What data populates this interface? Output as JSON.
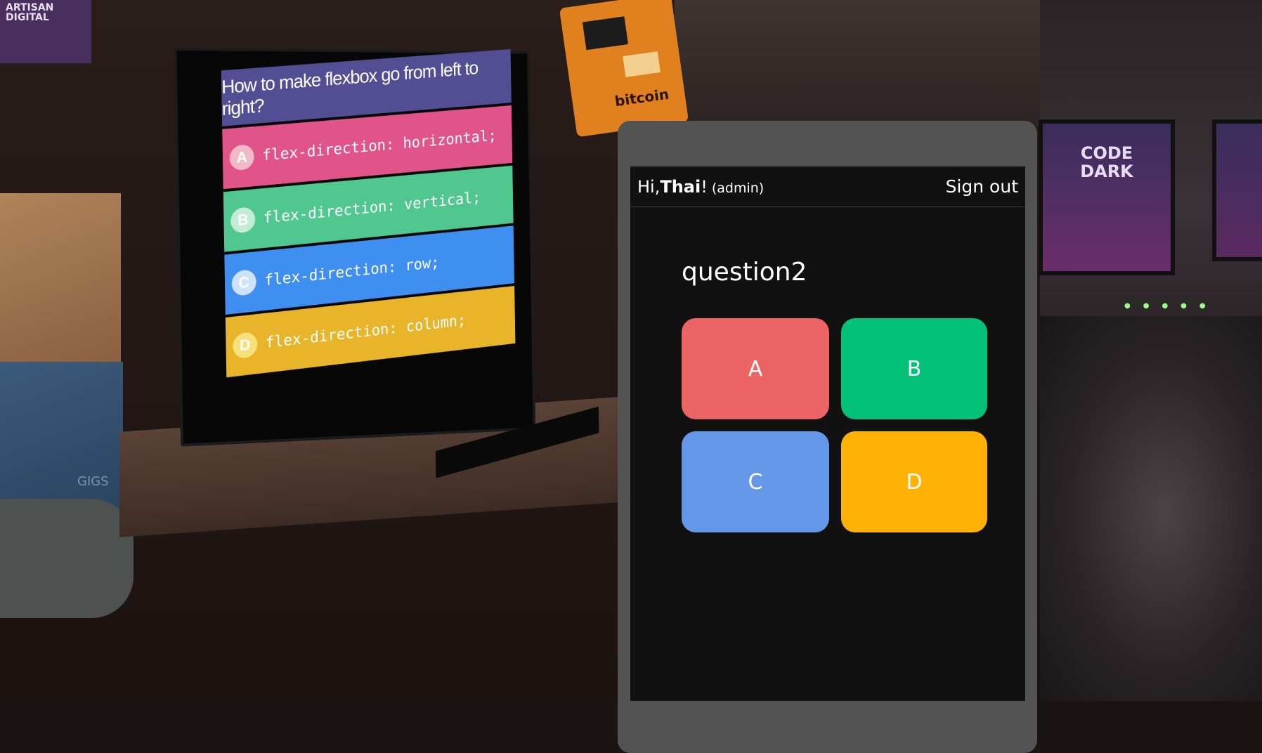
{
  "photo": {
    "banner_text": "ARTISAN DIGITAL",
    "atm_text": "bitcoin",
    "box_label": "GIGS",
    "monitor_text": "CODE DARK"
  },
  "tv": {
    "question": "How to make flexbox go from left to right?",
    "answers": [
      {
        "badge": "A",
        "code": "flex-direction: horizontal;",
        "color": "#e0548a",
        "badge_color": "#f2b8c6",
        "badge_text_color": "#ffffff"
      },
      {
        "badge": "B",
        "code": "flex-direction: vertical;",
        "color": "#4fc78e",
        "badge_color": "#c3ecd6",
        "badge_text_color": "#ffffff"
      },
      {
        "badge": "C",
        "code": "flex-direction: row;",
        "color": "#3f8ff0",
        "badge_color": "#cfe2fb",
        "badge_text_color": "#ffffff"
      },
      {
        "badge": "D",
        "code": "flex-direction: column;",
        "color": "#e8b42a",
        "badge_color": "#f7e17a",
        "badge_text_color": "#ffffff"
      }
    ]
  },
  "app": {
    "greeting_prefix": "Hi, ",
    "user_name": "Thai",
    "greeting_suffix": "!",
    "role": "(admin)",
    "signout_label": "Sign out",
    "question_title": "question2",
    "choices": [
      {
        "label": "A",
        "color": "#ec6464"
      },
      {
        "label": "B",
        "color": "#02c178"
      },
      {
        "label": "C",
        "color": "#6597e8"
      },
      {
        "label": "D",
        "color": "#ffb205"
      }
    ]
  }
}
